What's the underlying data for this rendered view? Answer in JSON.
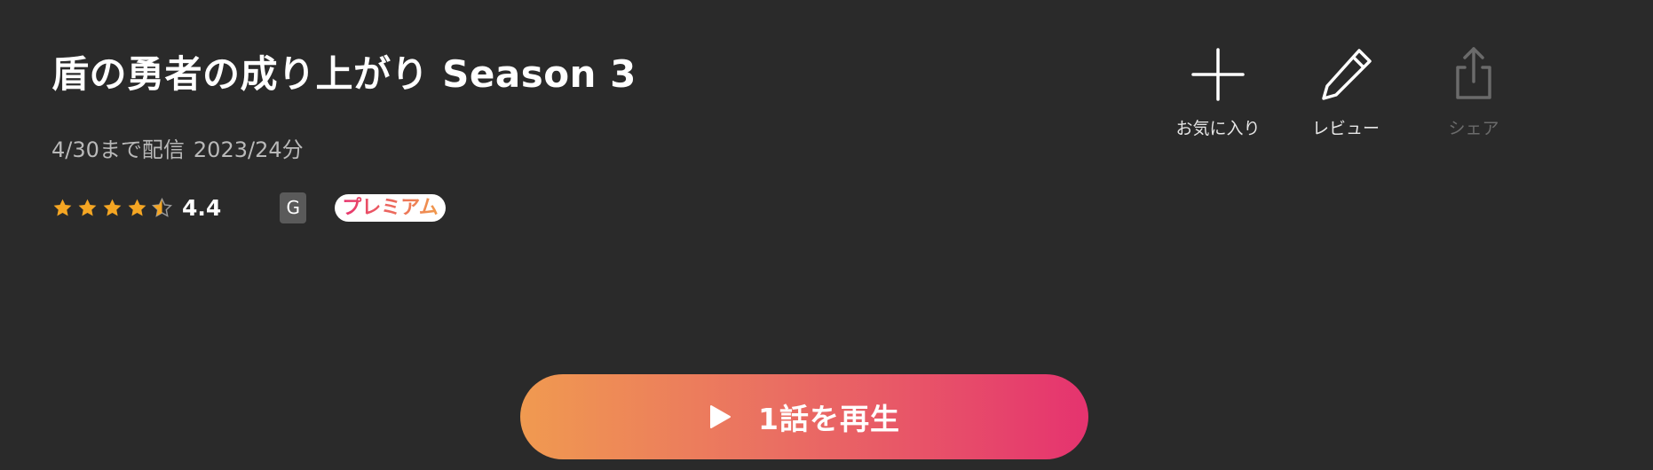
{
  "title": "盾の勇者の成り上がり Season 3",
  "meta": {
    "availability": "4/30まで配信",
    "year_duration": "2023/24分"
  },
  "rating": {
    "value": "4.4",
    "stars": 4.5,
    "star_color": "#f5a623",
    "empty_star_color": "#9a9a9a"
  },
  "age_rating": "G",
  "premium_label": "プレミアム",
  "actions": {
    "favorite": {
      "label": "お気に入り",
      "icon": "plus-icon"
    },
    "review": {
      "label": "レビュー",
      "icon": "pencil-icon"
    },
    "share": {
      "label": "シェア",
      "icon": "share-icon",
      "disabled": true
    }
  },
  "play": {
    "label": "1話を再生",
    "icon": "play-icon",
    "gradient": [
      "#f09a50",
      "#e5336f"
    ]
  }
}
